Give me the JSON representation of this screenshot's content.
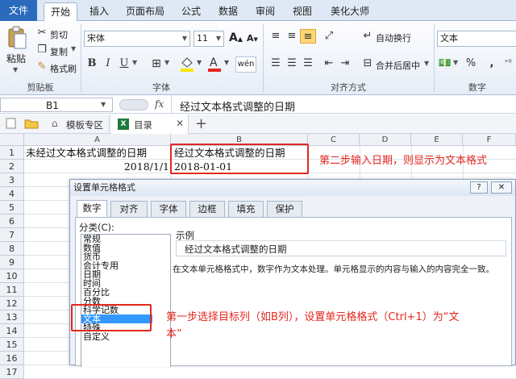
{
  "ribbon_tabs": [
    "文件",
    "开始",
    "插入",
    "页面布局",
    "公式",
    "数据",
    "审阅",
    "视图",
    "美化大师"
  ],
  "clipboard": {
    "paste": "粘贴",
    "cut": "剪切",
    "copy": "复制",
    "format_painter": "格式刷",
    "group": "剪贴板"
  },
  "font": {
    "name": "宋体",
    "size": "11",
    "bold": "B",
    "italic": "I",
    "underline": "U",
    "grow": "A",
    "shrink": "A",
    "wen": "wén",
    "group": "字体"
  },
  "alignment": {
    "wrap": "自动换行",
    "merge": "合并后居中",
    "group": "对齐方式"
  },
  "number": {
    "format": "文本",
    "percent": "%",
    "comma": ",",
    "group": "数字"
  },
  "formula_bar": {
    "name_box": "B1",
    "fx": "fx",
    "content": "经过文本格式调整的日期"
  },
  "doc_tabs": {
    "template": "模板专区",
    "workbook": "目录",
    "add": "+"
  },
  "columns": [
    "A",
    "B",
    "C",
    "D",
    "E",
    "F"
  ],
  "rows": [
    "1",
    "2",
    "3",
    "4",
    "5",
    "6",
    "7",
    "8",
    "9",
    "10",
    "11",
    "12",
    "13",
    "14",
    "15",
    "16",
    "17"
  ],
  "cells": {
    "a1": "未经过文本格式调整的日期",
    "b1": "经过文本格式调整的日期",
    "a2": "2018/1/1",
    "b2": "2018-01-01"
  },
  "annotations": {
    "step2": "第二步输入日期，则显示为文本格式",
    "step1_line1": "第一步选择目标列（如B列），设置单元格格式（Ctrl+1）为“文",
    "step1_line2": "本”"
  },
  "dialog": {
    "title": "设置单元格格式",
    "help": "?",
    "close": "✕",
    "tabs": [
      "数字",
      "对齐",
      "字体",
      "边框",
      "填充",
      "保护"
    ],
    "category_label": "分类(C):",
    "categories": [
      "常规",
      "数值",
      "货币",
      "会计专用",
      "日期",
      "时间",
      "百分比",
      "分数",
      "科学记数",
      "文本",
      "特殊",
      "自定义"
    ],
    "selected": "文本",
    "sample_label": "示例",
    "sample_value": "经过文本格式调整的日期",
    "description": "在文本单元格格式中，数字作为文本处理。单元格显示的内容与输入的内容完全一致。"
  },
  "colors": {
    "accent": "#2a6bbd",
    "annotation": "#e3271f",
    "selection": "#3399ff"
  }
}
